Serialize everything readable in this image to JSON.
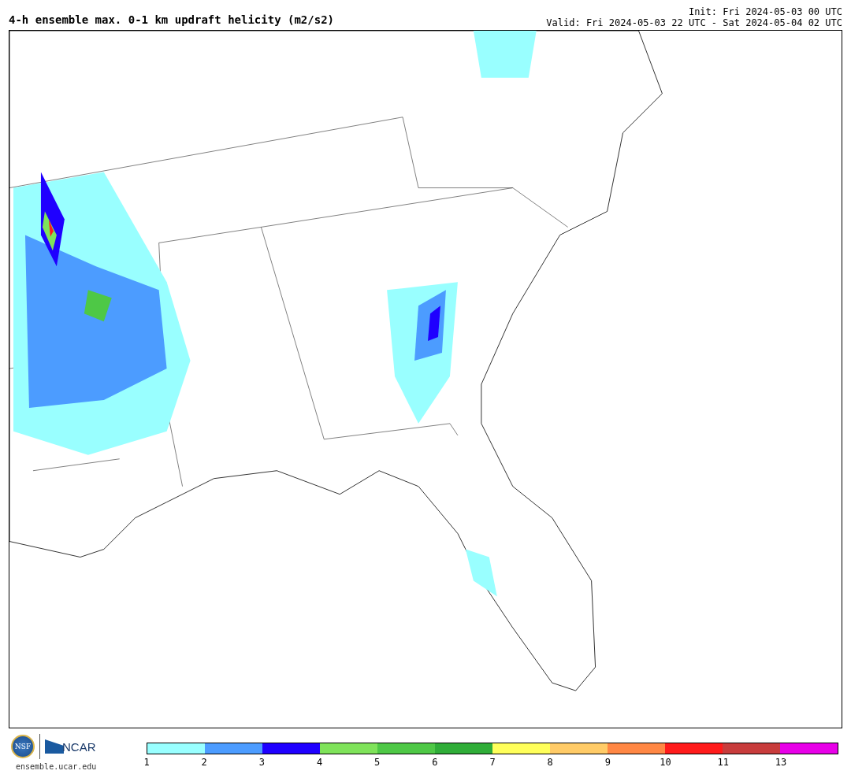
{
  "title": "4-h ensemble max. 0-1 km updraft helicity (m2/s2)",
  "init": "Init: Fri 2024-05-03 00 UTC",
  "valid": "Valid: Fri 2024-05-03 22 UTC - Sat 2024-05-04 02 UTC",
  "footer": {
    "logo_left": "NSF",
    "logo_right": "NCAR",
    "site": "ensemble.ucar.edu"
  },
  "colorbar": [
    {
      "label": "1",
      "color": "#99ffff"
    },
    {
      "label": "2",
      "color": "#4c9cff"
    },
    {
      "label": "3",
      "color": "#1f00ff"
    },
    {
      "label": "4",
      "color": "#7fe35a"
    },
    {
      "label": "5",
      "color": "#4ec846"
    },
    {
      "label": "6",
      "color": "#2fad38"
    },
    {
      "label": "7",
      "color": "#ffff5a"
    },
    {
      "label": "8",
      "color": "#ffcb67"
    },
    {
      "label": "9",
      "color": "#ff8744"
    },
    {
      "label": "10",
      "color": "#ff1b1b"
    },
    {
      "label": "11",
      "color": "#c83c3c"
    },
    {
      "label": "13",
      "color": "#e800e8"
    }
  ]
}
